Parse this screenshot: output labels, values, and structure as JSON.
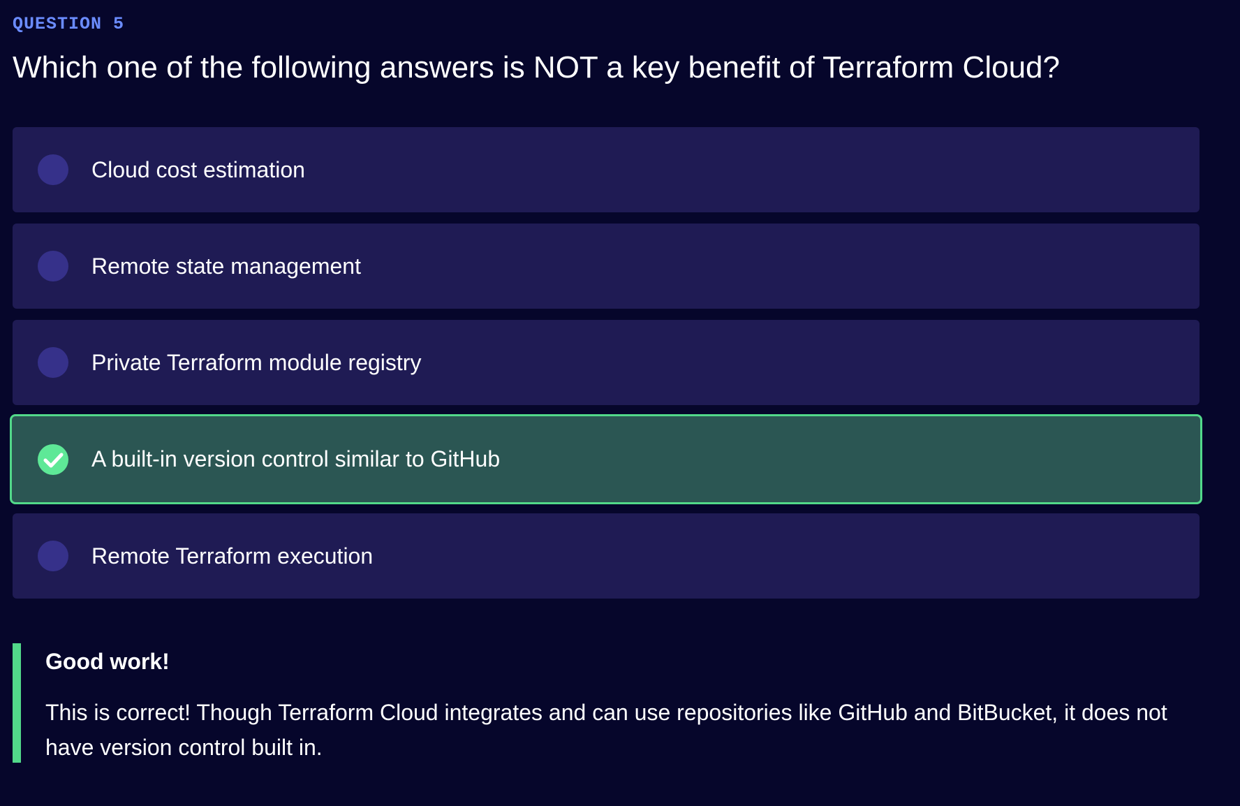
{
  "question": {
    "label": "QUESTION 5",
    "text": "Which one of the following answers is NOT a key benefit of Terraform Cloud?"
  },
  "options": [
    {
      "label": "Cloud cost estimation",
      "state": "unselected"
    },
    {
      "label": "Remote state management",
      "state": "unselected"
    },
    {
      "label": "Private Terraform module registry",
      "state": "unselected"
    },
    {
      "label": "A built-in version control similar to GitHub",
      "state": "selected-correct"
    },
    {
      "label": "Remote Terraform execution",
      "state": "unselected"
    }
  ],
  "feedback": {
    "title": "Good work!",
    "body": "This is correct! Though Terraform Cloud integrates and can use repositories like GitHub and BitBucket, it does not have version control built in."
  },
  "colors": {
    "background": "#06062b",
    "question_label": "#6b8cff",
    "option_background": "#1f1b54",
    "radio": "#36318a",
    "correct_background": "#2b5653",
    "correct_accent": "#52d98a",
    "checkmark_fill": "#5ee897"
  },
  "icons": {
    "unselected": "radio-empty-icon",
    "correct": "check-circle-icon"
  }
}
